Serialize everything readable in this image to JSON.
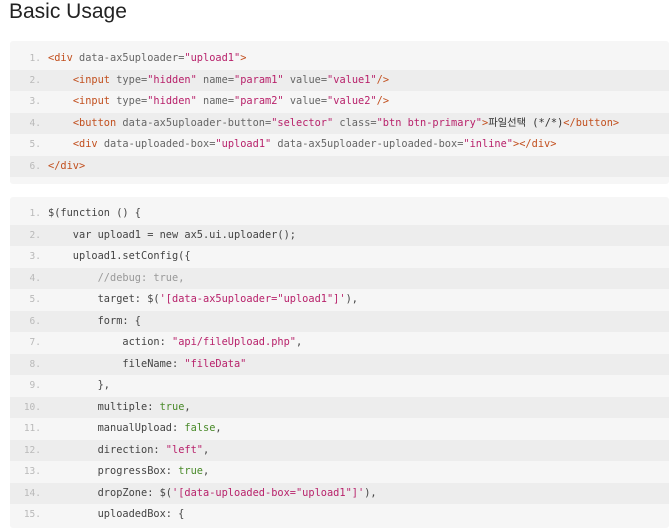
{
  "title": "Basic Usage",
  "colors": {
    "block_bg": "#f6f6f6",
    "alt_line_bg": "#ededed",
    "line_number": "#b9b9b9",
    "tag": "#c2501f",
    "attribute": "#666666",
    "string": "#b8226b",
    "boolean": "#4a8a2a",
    "comment": "#999999"
  },
  "html_block": {
    "lines": [
      {
        "no": "1.",
        "tokens": [
          {
            "t": "tag",
            "v": "<div"
          },
          {
            "t": "attr",
            "v": " data-ax5uploader="
          },
          {
            "t": "str",
            "v": "\"upload1\""
          },
          {
            "t": "tag",
            "v": ">"
          }
        ]
      },
      {
        "no": "2.",
        "tokens": [
          {
            "t": "plain",
            "v": "    "
          },
          {
            "t": "tag",
            "v": "<input"
          },
          {
            "t": "attr",
            "v": " type="
          },
          {
            "t": "str",
            "v": "\"hidden\""
          },
          {
            "t": "attr",
            "v": " name="
          },
          {
            "t": "str",
            "v": "\"param1\""
          },
          {
            "t": "attr",
            "v": " value="
          },
          {
            "t": "str",
            "v": "\"value1\""
          },
          {
            "t": "tag",
            "v": "/>"
          }
        ]
      },
      {
        "no": "3.",
        "tokens": [
          {
            "t": "plain",
            "v": "    "
          },
          {
            "t": "tag",
            "v": "<input"
          },
          {
            "t": "attr",
            "v": " type="
          },
          {
            "t": "str",
            "v": "\"hidden\""
          },
          {
            "t": "attr",
            "v": " name="
          },
          {
            "t": "str",
            "v": "\"param2\""
          },
          {
            "t": "attr",
            "v": " value="
          },
          {
            "t": "str",
            "v": "\"value2\""
          },
          {
            "t": "tag",
            "v": "/>"
          }
        ]
      },
      {
        "no": "4.",
        "tokens": [
          {
            "t": "plain",
            "v": "    "
          },
          {
            "t": "tag",
            "v": "<button"
          },
          {
            "t": "attr",
            "v": " data-ax5uploader-button="
          },
          {
            "t": "str",
            "v": "\"selector\""
          },
          {
            "t": "attr",
            "v": " class="
          },
          {
            "t": "str",
            "v": "\"btn btn-primary\""
          },
          {
            "t": "tag",
            "v": ">"
          },
          {
            "t": "text",
            "v": "파일선택 (*/*)"
          },
          {
            "t": "tag",
            "v": "</button>"
          }
        ]
      },
      {
        "no": "5.",
        "tokens": [
          {
            "t": "plain",
            "v": "    "
          },
          {
            "t": "tag",
            "v": "<div"
          },
          {
            "t": "attr",
            "v": " data-uploaded-box="
          },
          {
            "t": "str",
            "v": "\"upload1\""
          },
          {
            "t": "attr",
            "v": " data-ax5uploader-uploaded-box="
          },
          {
            "t": "str",
            "v": "\"inline\""
          },
          {
            "t": "tag",
            "v": "></div>"
          }
        ]
      },
      {
        "no": "6.",
        "tokens": [
          {
            "t": "tag",
            "v": "</div>"
          }
        ]
      }
    ]
  },
  "js_block": {
    "lines": [
      {
        "no": "1.",
        "tokens": [
          {
            "t": "plain",
            "v": "$(function () {"
          }
        ]
      },
      {
        "no": "2.",
        "tokens": [
          {
            "t": "plain",
            "v": "    var upload1 = new ax5.ui.uploader();"
          }
        ]
      },
      {
        "no": "3.",
        "tokens": [
          {
            "t": "plain",
            "v": "    upload1.setConfig({"
          }
        ]
      },
      {
        "no": "4.",
        "tokens": [
          {
            "t": "plain",
            "v": "        "
          },
          {
            "t": "comment",
            "v": "//debug: true,"
          }
        ]
      },
      {
        "no": "5.",
        "tokens": [
          {
            "t": "plain",
            "v": "        target: $("
          },
          {
            "t": "str",
            "v": "'[data-ax5uploader=\"upload1\"]'"
          },
          {
            "t": "plain",
            "v": "),"
          }
        ]
      },
      {
        "no": "6.",
        "tokens": [
          {
            "t": "plain",
            "v": "        form: {"
          }
        ]
      },
      {
        "no": "7.",
        "tokens": [
          {
            "t": "plain",
            "v": "            action: "
          },
          {
            "t": "str",
            "v": "\"api/fileUpload.php\""
          },
          {
            "t": "plain",
            "v": ","
          }
        ]
      },
      {
        "no": "8.",
        "tokens": [
          {
            "t": "plain",
            "v": "            fileName: "
          },
          {
            "t": "str",
            "v": "\"fileData\""
          }
        ]
      },
      {
        "no": "9.",
        "tokens": [
          {
            "t": "plain",
            "v": "        },"
          }
        ]
      },
      {
        "no": "10.",
        "tokens": [
          {
            "t": "plain",
            "v": "        multiple: "
          },
          {
            "t": "bool",
            "v": "true"
          },
          {
            "t": "plain",
            "v": ","
          }
        ]
      },
      {
        "no": "11.",
        "tokens": [
          {
            "t": "plain",
            "v": "        manualUpload: "
          },
          {
            "t": "bool",
            "v": "false"
          },
          {
            "t": "plain",
            "v": ","
          }
        ]
      },
      {
        "no": "12.",
        "tokens": [
          {
            "t": "plain",
            "v": "        direction: "
          },
          {
            "t": "str",
            "v": "\"left\""
          },
          {
            "t": "plain",
            "v": ","
          }
        ]
      },
      {
        "no": "13.",
        "tokens": [
          {
            "t": "plain",
            "v": "        progressBox: "
          },
          {
            "t": "bool",
            "v": "true"
          },
          {
            "t": "plain",
            "v": ","
          }
        ]
      },
      {
        "no": "14.",
        "tokens": [
          {
            "t": "plain",
            "v": "        dropZone: $("
          },
          {
            "t": "str",
            "v": "'[data-uploaded-box=\"upload1\"]'"
          },
          {
            "t": "plain",
            "v": "),"
          }
        ]
      },
      {
        "no": "15.",
        "tokens": [
          {
            "t": "plain",
            "v": "        uploadedBox: {"
          }
        ]
      }
    ]
  }
}
